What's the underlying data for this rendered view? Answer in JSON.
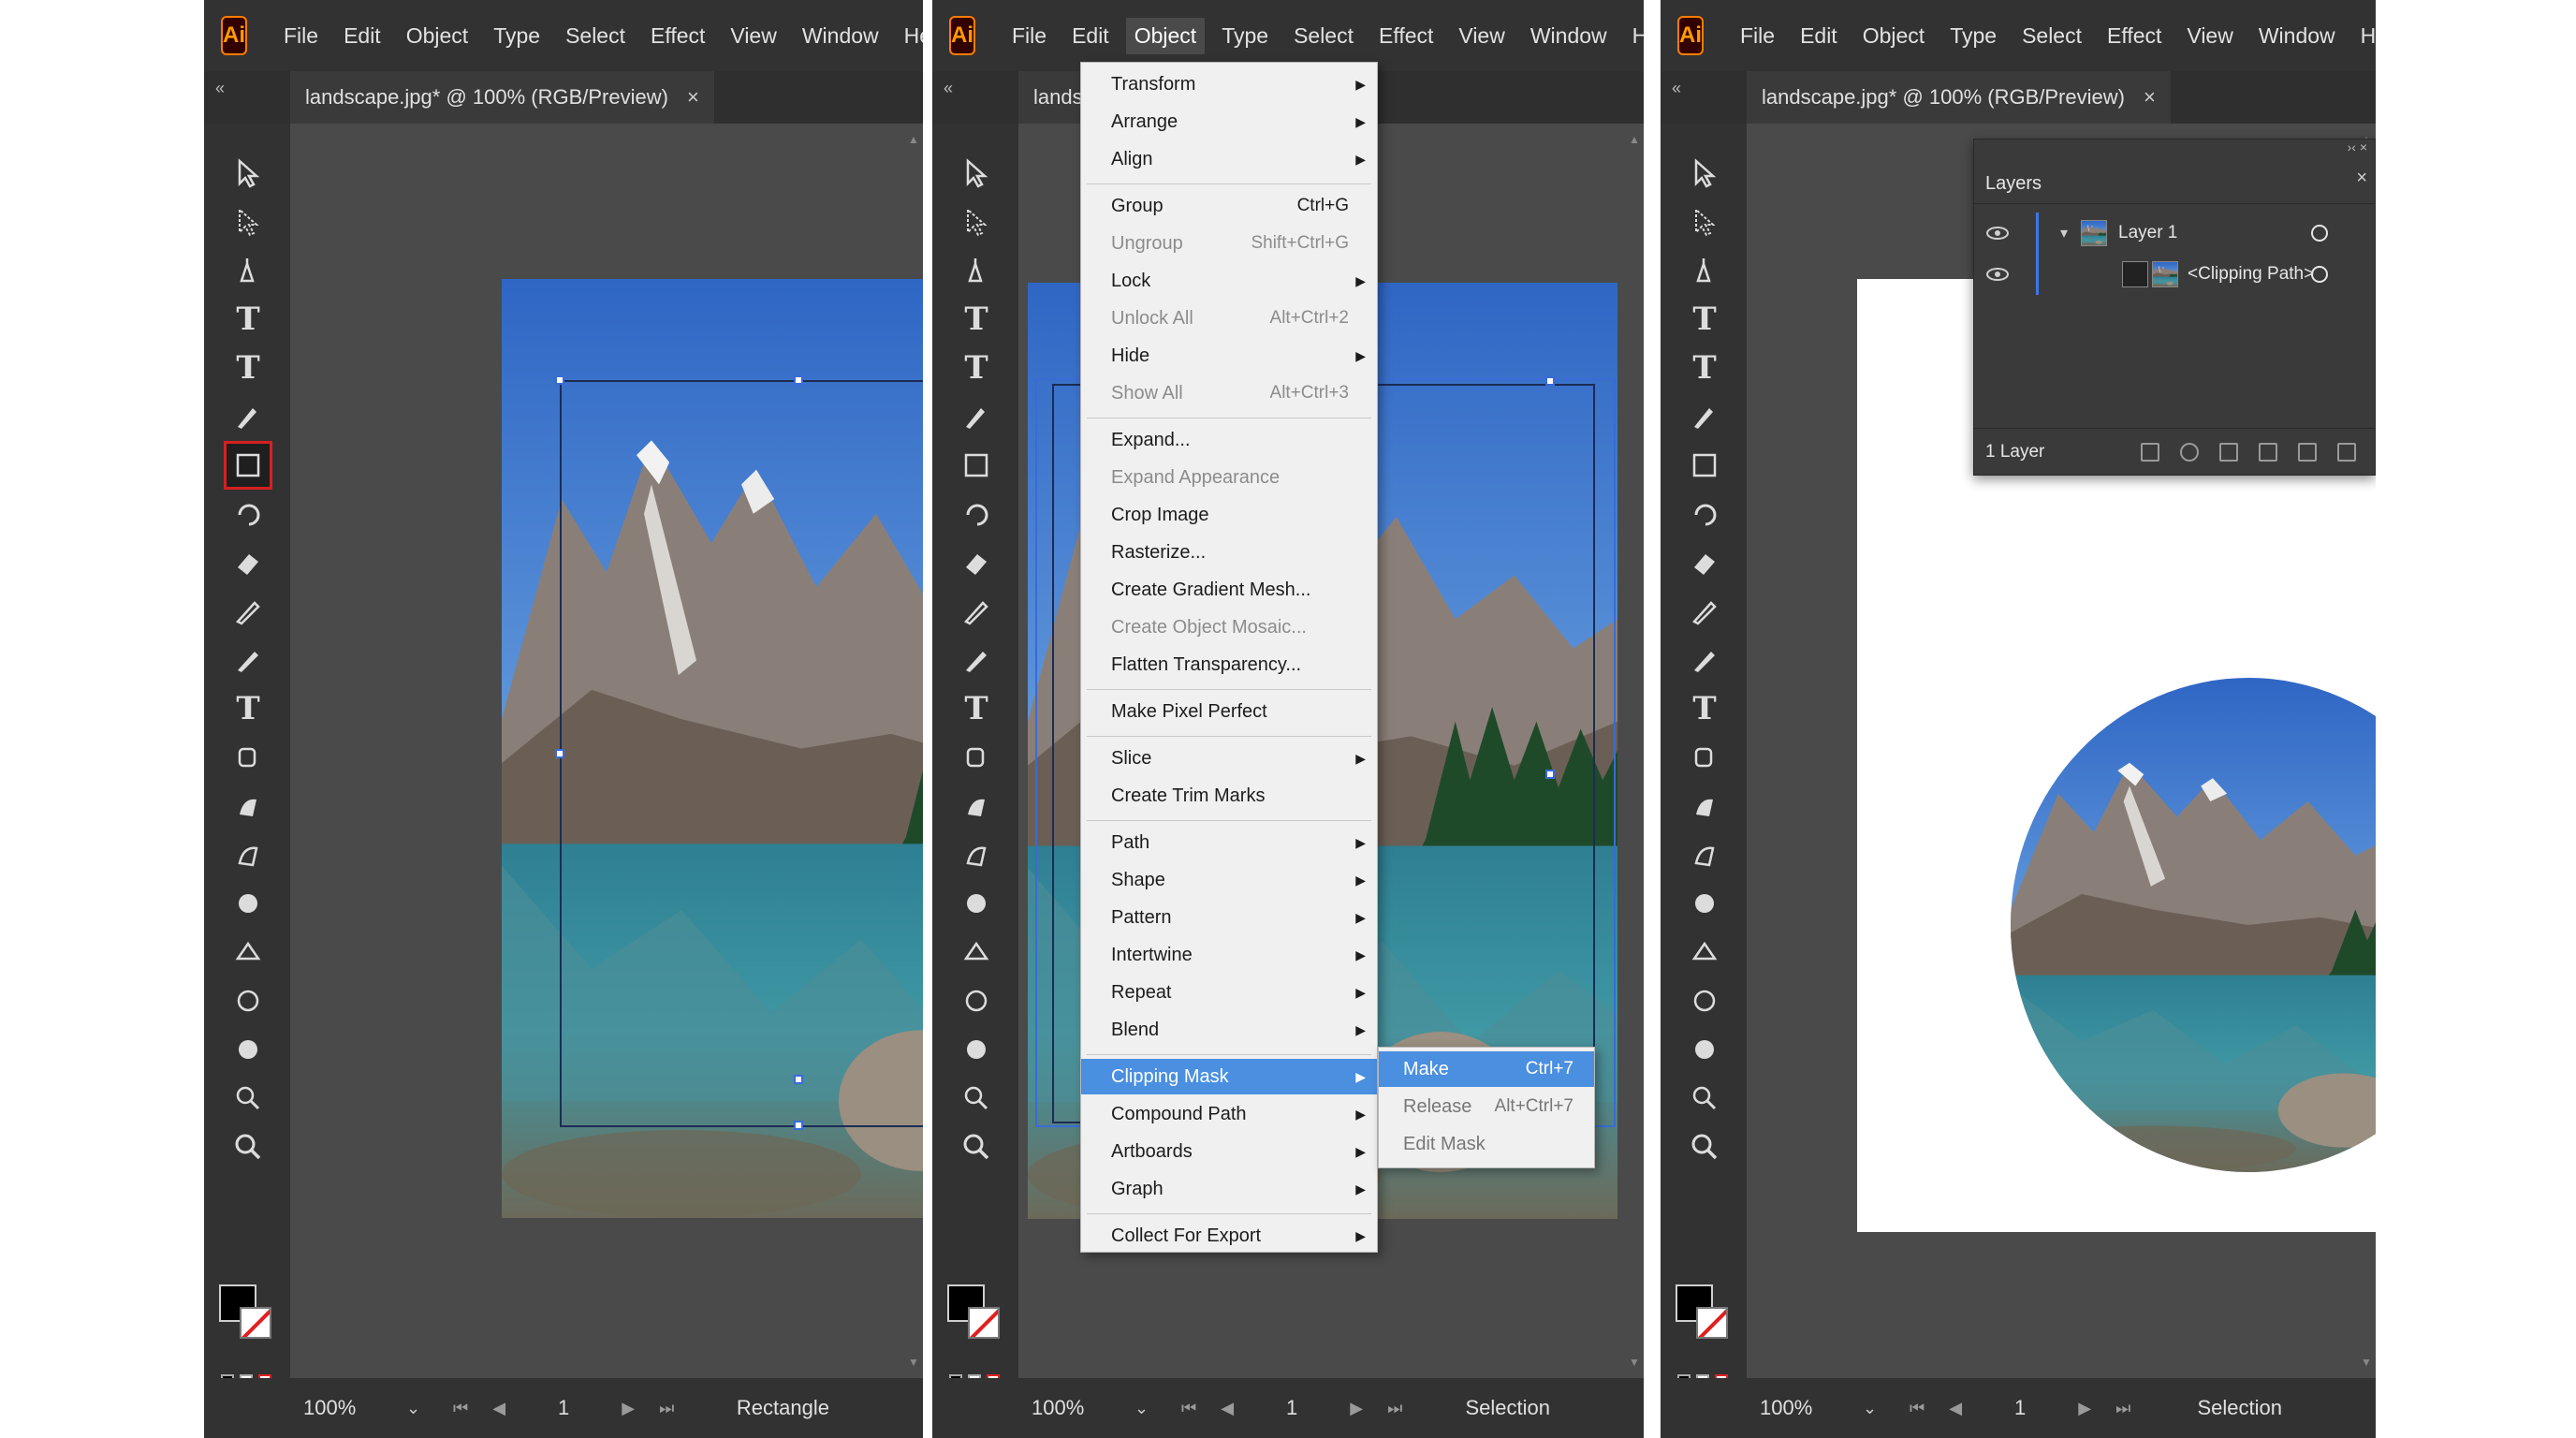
{
  "menu": [
    "File",
    "Edit",
    "Object",
    "Type",
    "Select",
    "Effect",
    "View",
    "Window",
    "Help"
  ],
  "app_logo": "Ai",
  "collapse_glyph": "«",
  "doc_tab": {
    "title": "landscape.jpg* @ 100% (RGB/Preview)",
    "title_truncated": "landsca",
    "close": "×"
  },
  "type_tool_glyph": "T",
  "status": {
    "zoom": "100%",
    "page": "1",
    "tool_panel1": "Rectangle",
    "tool_panel2": "Selection",
    "tool_panel3": "Selection"
  },
  "object_menu": [
    {
      "label": "Transform",
      "submenu": true
    },
    {
      "label": "Arrange",
      "submenu": true
    },
    {
      "label": "Align",
      "submenu": true
    },
    {
      "sep": true
    },
    {
      "label": "Group",
      "shortcut": "Ctrl+G"
    },
    {
      "label": "Ungroup",
      "shortcut": "Shift+Ctrl+G",
      "disabled": true
    },
    {
      "label": "Lock",
      "submenu": true
    },
    {
      "label": "Unlock All",
      "shortcut": "Alt+Ctrl+2",
      "disabled": true
    },
    {
      "label": "Hide",
      "submenu": true
    },
    {
      "label": "Show All",
      "shortcut": "Alt+Ctrl+3",
      "disabled": true
    },
    {
      "sep": true
    },
    {
      "label": "Expand..."
    },
    {
      "label": "Expand Appearance",
      "disabled": true
    },
    {
      "label": "Crop Image"
    },
    {
      "label": "Rasterize..."
    },
    {
      "label": "Create Gradient Mesh..."
    },
    {
      "label": "Create Object Mosaic...",
      "disabled": true
    },
    {
      "label": "Flatten Transparency..."
    },
    {
      "sep": true
    },
    {
      "label": "Make Pixel Perfect"
    },
    {
      "sep": true
    },
    {
      "label": "Slice",
      "submenu": true
    },
    {
      "label": "Create Trim Marks"
    },
    {
      "sep": true
    },
    {
      "label": "Path",
      "submenu": true
    },
    {
      "label": "Shape",
      "submenu": true
    },
    {
      "label": "Pattern",
      "submenu": true
    },
    {
      "label": "Intertwine",
      "submenu": true
    },
    {
      "label": "Repeat",
      "submenu": true
    },
    {
      "label": "Blend",
      "submenu": true
    },
    {
      "sep": true
    },
    {
      "label": "Clipping Mask",
      "submenu": true,
      "hover": true
    },
    {
      "label": "Compound Path",
      "submenu": true
    },
    {
      "label": "Artboards",
      "submenu": true
    },
    {
      "label": "Graph",
      "submenu": true
    },
    {
      "sep": true
    },
    {
      "label": "Collect For Export",
      "submenu": true
    }
  ],
  "clipping_submenu": [
    {
      "label": "Make",
      "shortcut": "Ctrl+7",
      "hover": true
    },
    {
      "label": "Release",
      "shortcut": "Alt+Ctrl+7",
      "disabled": true
    },
    {
      "label": "Edit Mask",
      "disabled": true
    }
  ],
  "layers_panel": {
    "title": "Layers",
    "layer_name": "Layer 1",
    "sublayer_name": "<Clipping Path>",
    "count": "1 Layer"
  },
  "colors": {
    "accent": "#4a8fe0",
    "selected_tool_outline": "#d62020",
    "layer_bar": "#3b78e7"
  },
  "icons": [
    "selection-icon",
    "direct-selection-icon",
    "pen-icon",
    "type-icon",
    "paintbrush-icon",
    "rectangle-icon",
    "rotate-icon",
    "eraser-icon",
    "pencil-icon",
    "zoom-icon",
    "eye-icon",
    "layer-thumbnail-icon",
    "trash-icon"
  ]
}
